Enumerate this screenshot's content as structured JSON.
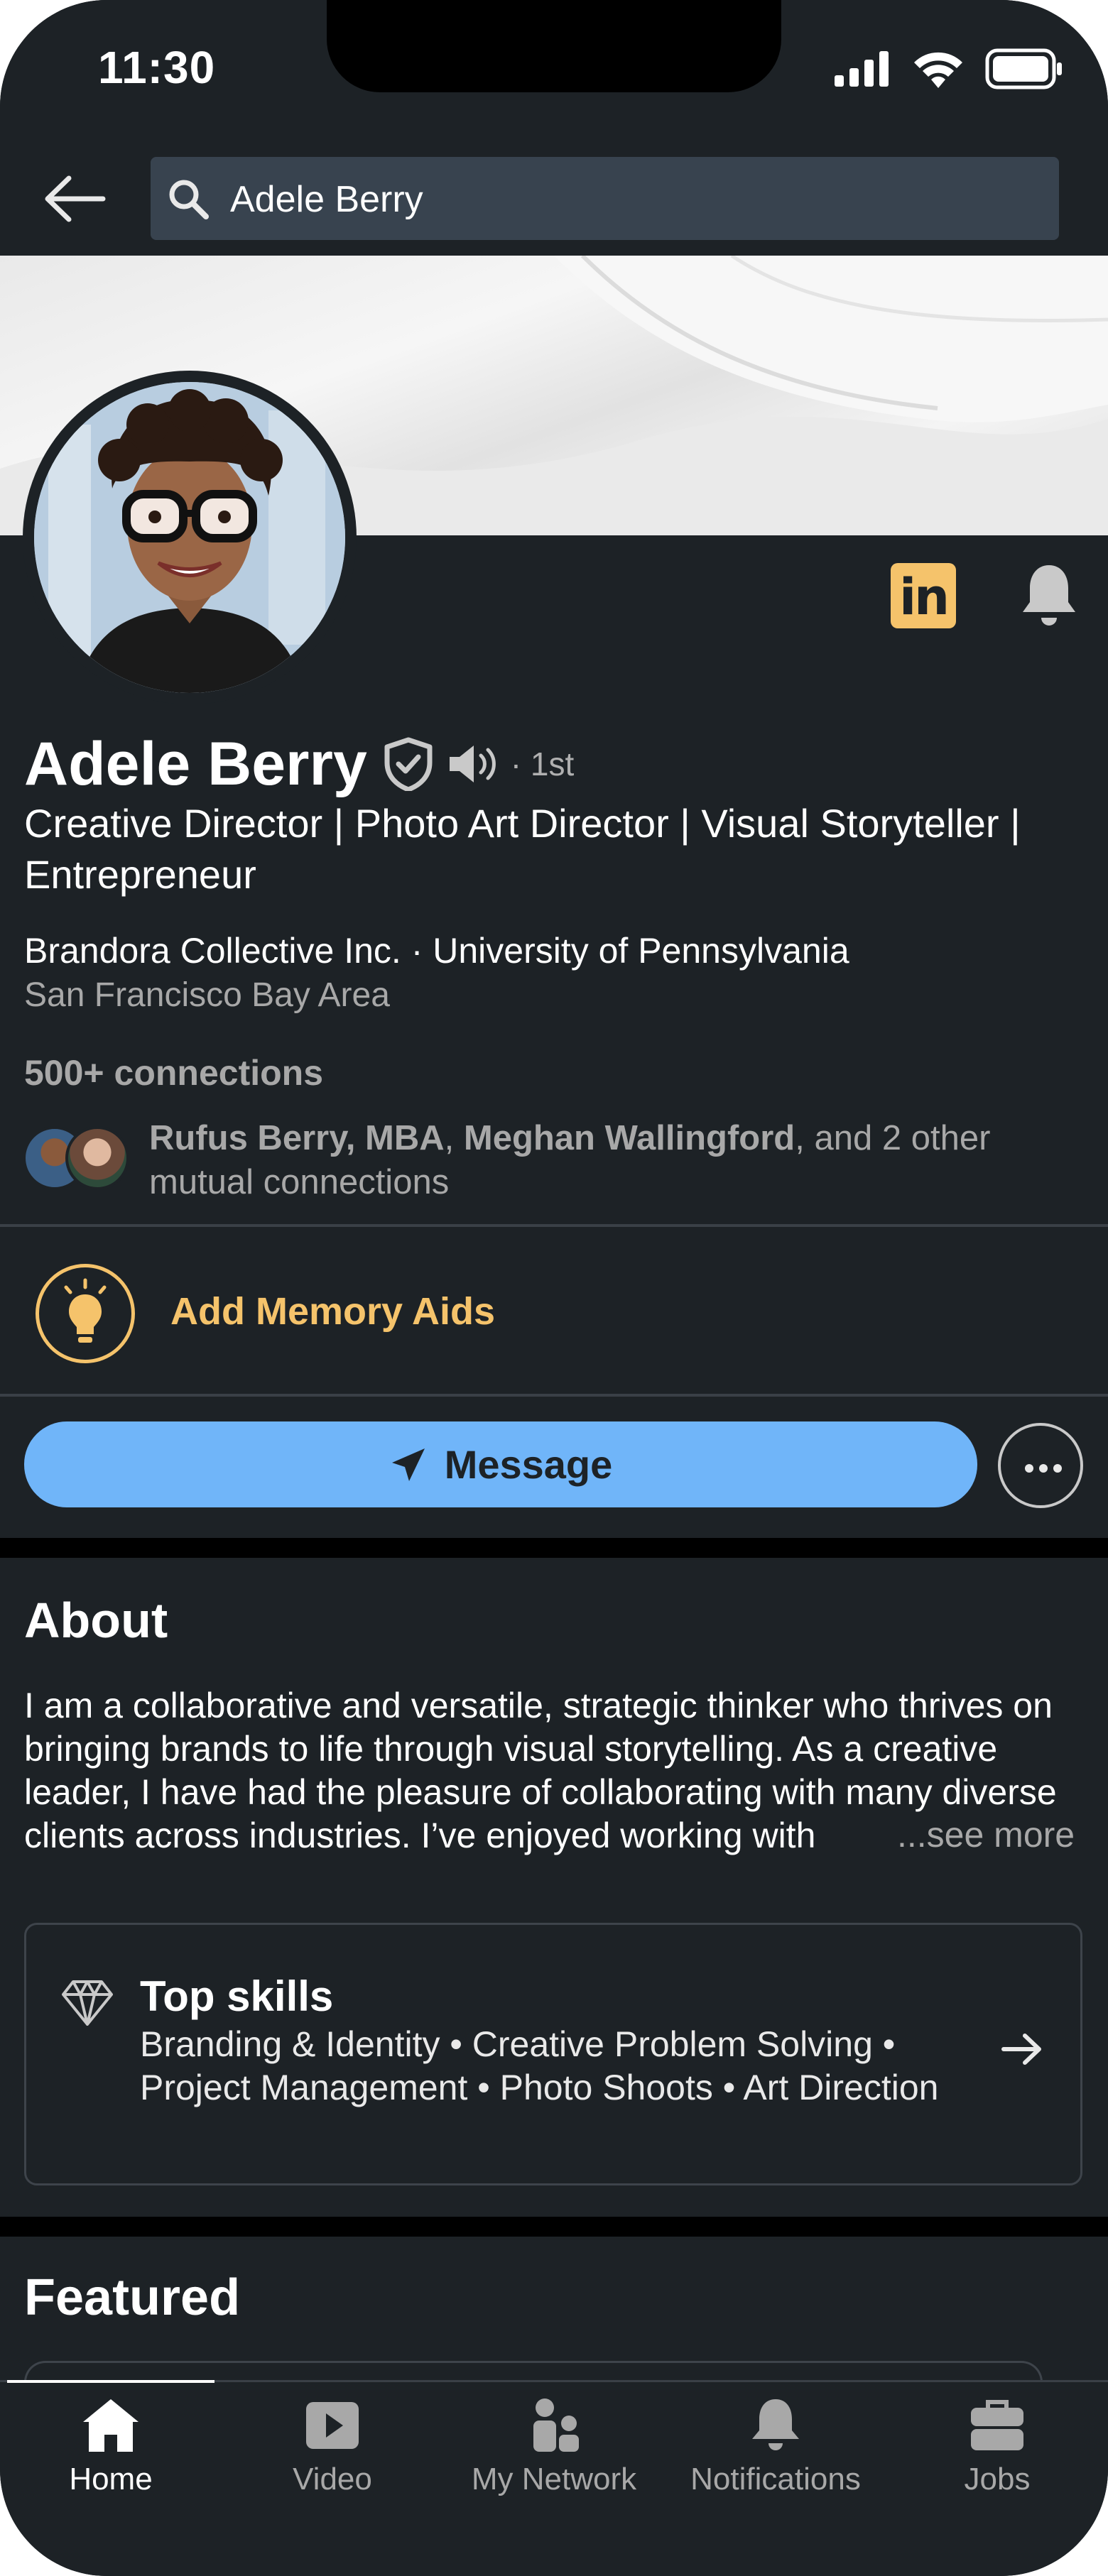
{
  "status_bar": {
    "time": "11:30"
  },
  "search": {
    "query": "Adele Berry"
  },
  "profile": {
    "name": "Adele Berry",
    "degree": "· 1st",
    "headline": "Creative Director | Photo Art Director | Visual Storyteller | Entrepreneur",
    "company": "Brandora Collective Inc. · University of Pennsylvania",
    "location": "San Francisco Bay Area",
    "connections": "500+ connections",
    "mutual": {
      "name1": "Rufus Berry, MBA",
      "sep": ", ",
      "name2": "Meghan Wallingford",
      "rest": ", and 2 other mutual connections"
    }
  },
  "memory_aids": {
    "label": "Add Memory Aids"
  },
  "actions": {
    "message_label": "Message"
  },
  "about": {
    "title": "About",
    "text": "I am a collaborative and versatile, strategic thinker who thrives on bringing brands to life through visual storytelling. As a creative leader, I have had the pleasure of collaborating with many diverse clients across industries. I’ve enjoyed working with",
    "see_more": "...see more"
  },
  "top_skills": {
    "title": "Top skills",
    "text": "Branding & Identity • Creative Problem Solving • Project Management • Photo Shoots • Art Direction"
  },
  "featured": {
    "title": "Featured"
  },
  "tabs": [
    {
      "label": "Home",
      "icon": "home-icon",
      "active": true
    },
    {
      "label": "Video",
      "icon": "video-icon"
    },
    {
      "label": "My Network",
      "icon": "network-icon"
    },
    {
      "label": "Notifications",
      "icon": "bell-icon"
    },
    {
      "label": "Jobs",
      "icon": "briefcase-icon"
    }
  ],
  "colors": {
    "background": "#1d2226",
    "accent_blue": "#70b5f9",
    "accent_gold": "#f5c36b",
    "muted_text": "#a8a8a8"
  }
}
